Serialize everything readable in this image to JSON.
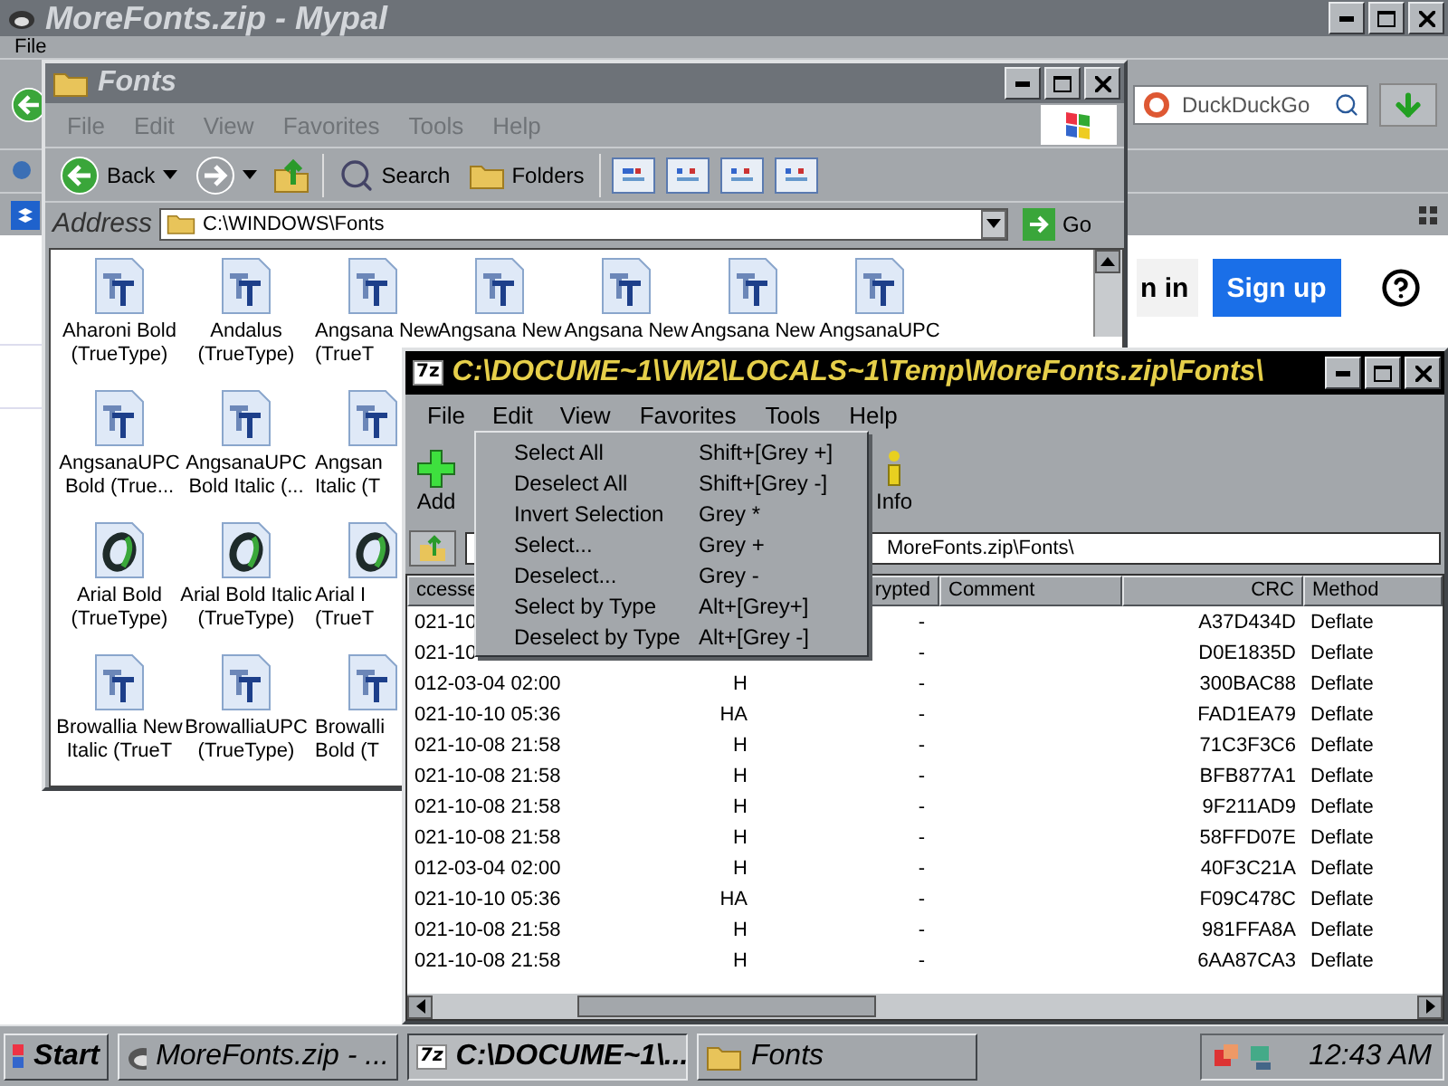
{
  "browser": {
    "title": "MoreFonts.zip - Mypal",
    "active": false,
    "menu": [
      "File"
    ],
    "search": {
      "placeholder": "DuckDuckGo"
    },
    "page": {
      "sign_in": "n in",
      "sign_up": "Sign up"
    }
  },
  "fonts_window": {
    "title": "Fonts",
    "active": false,
    "menu": [
      "File",
      "Edit",
      "View",
      "Favorites",
      "Tools",
      "Help"
    ],
    "toolbar": {
      "back": "Back",
      "search": "Search",
      "folders": "Folders"
    },
    "address": {
      "label": "Address",
      "value": "C:\\WINDOWS\\Fonts",
      "go": "Go"
    },
    "rows": [
      [
        {
          "kind": "truetype",
          "lines": [
            "Aharoni Bold",
            "(TrueType)"
          ]
        },
        {
          "kind": "truetype",
          "lines": [
            "Andalus",
            "(TrueType)"
          ]
        },
        {
          "kind": "truetype",
          "lines": [
            "Angsana New",
            "(TrueT"
          ]
        },
        {
          "kind": "truetype",
          "lines": [
            "Angsana New"
          ]
        },
        {
          "kind": "truetype",
          "lines": [
            "Angsana New"
          ]
        },
        {
          "kind": "truetype",
          "lines": [
            "Angsana New"
          ]
        },
        {
          "kind": "truetype",
          "lines": [
            "AngsanaUPC"
          ]
        }
      ],
      [
        {
          "kind": "truetype",
          "lines": [
            "AngsanaUPC",
            "Bold (True..."
          ]
        },
        {
          "kind": "truetype",
          "lines": [
            "AngsanaUPC",
            "Bold Italic (..."
          ]
        },
        {
          "kind": "truetype",
          "lines": [
            "Angsan",
            "Italic (T"
          ]
        }
      ],
      [
        {
          "kind": "opentype",
          "lines": [
            "Arial Bold",
            "(TrueType)"
          ]
        },
        {
          "kind": "opentype",
          "lines": [
            "Arial Bold Italic",
            "(TrueType)"
          ]
        },
        {
          "kind": "opentype",
          "lines": [
            "Arial I",
            "(TrueT"
          ]
        }
      ],
      [
        {
          "kind": "truetype",
          "lines": [
            "Browallia New",
            "Italic (TrueT"
          ]
        },
        {
          "kind": "truetype",
          "lines": [
            "BrowalliaUPC",
            "(TrueType)"
          ]
        },
        {
          "kind": "truetype",
          "lines": [
            "Browalli",
            "Bold (T"
          ]
        }
      ]
    ]
  },
  "zip_window": {
    "logo": "7z",
    "title": "C:\\DOCUME~1\\VM2\\LOCALS~1\\Temp\\MoreFonts.zip\\Fonts\\",
    "active": true,
    "menu": [
      {
        "label": "File",
        "selected": false
      },
      {
        "label": "Edit",
        "selected": true
      },
      {
        "label": "View",
        "selected": false
      },
      {
        "label": "Favorites",
        "selected": false
      },
      {
        "label": "Tools",
        "selected": false
      },
      {
        "label": "Help",
        "selected": false
      }
    ],
    "toolbar": [
      {
        "kind": "add",
        "label": "Add"
      },
      {
        "kind": "info",
        "label": "Info"
      }
    ],
    "path": "MoreFonts.zip\\Fonts\\",
    "columns": {
      "accessed": "ccesse",
      "encrypted": "rypted",
      "comment": "Comment",
      "crc": "CRC",
      "method": "Method"
    },
    "rows": [
      {
        "accessed": "021-10",
        "encrypted": "-",
        "crc": "A37D434D",
        "method": "Deflate"
      },
      {
        "accessed": "021-10",
        "encrypted": "-",
        "crc": "D0E1835D",
        "method": "Deflate"
      },
      {
        "accessed": "012-03-04 02:00",
        "attributes": "H",
        "encrypted": "-",
        "crc": "300BAC88",
        "method": "Deflate"
      },
      {
        "accessed": "021-10-10 05:36",
        "attributes": "HA",
        "encrypted": "-",
        "crc": "FAD1EA79",
        "method": "Deflate"
      },
      {
        "accessed": "021-10-08 21:58",
        "attributes": "H",
        "encrypted": "-",
        "crc": "71C3F3C6",
        "method": "Deflate"
      },
      {
        "accessed": "021-10-08 21:58",
        "attributes": "H",
        "encrypted": "-",
        "crc": "BFB877A1",
        "method": "Deflate"
      },
      {
        "accessed": "021-10-08 21:58",
        "attributes": "H",
        "encrypted": "-",
        "crc": "9F211AD9",
        "method": "Deflate"
      },
      {
        "accessed": "021-10-08 21:58",
        "attributes": "H",
        "encrypted": "-",
        "crc": "58FFD07E",
        "method": "Deflate"
      },
      {
        "accessed": "012-03-04 02:00",
        "attributes": "H",
        "encrypted": "-",
        "crc": "40F3C21A",
        "method": "Deflate"
      },
      {
        "accessed": "021-10-10 05:36",
        "attributes": "HA",
        "encrypted": "-",
        "crc": "F09C478C",
        "method": "Deflate"
      },
      {
        "accessed": "021-10-08 21:58",
        "attributes": "H",
        "encrypted": "-",
        "crc": "981FFA8A",
        "method": "Deflate"
      },
      {
        "accessed": "021-10-08 21:58",
        "attributes": "H",
        "encrypted": "-",
        "crc": "6AA87CA3",
        "method": "Deflate"
      }
    ],
    "edit_menu": [
      {
        "label": "Select All",
        "shortcut": "Shift+[Grey +]"
      },
      {
        "label": "Deselect All",
        "shortcut": "Shift+[Grey -]"
      },
      {
        "label": "Invert Selection",
        "shortcut": "Grey *"
      },
      {
        "label": "Select...",
        "shortcut": "Grey +"
      },
      {
        "label": "Deselect...",
        "shortcut": "Grey -"
      },
      {
        "label": "Select by Type",
        "shortcut": "Alt+[Grey+]"
      },
      {
        "label": "Deselect by Type",
        "shortcut": "Alt+[Grey -]"
      }
    ]
  },
  "taskbar": {
    "start": "Start",
    "tasks": [
      {
        "kind": "browser",
        "label": "MoreFonts.zip - ...",
        "selected": false
      },
      {
        "kind": "zip",
        "logo": "7z",
        "label": "C:\\DOCUME~1\\...",
        "selected": true
      },
      {
        "kind": "folder",
        "label": "Fonts",
        "selected": false
      }
    ],
    "clock": "12:43 AM"
  }
}
